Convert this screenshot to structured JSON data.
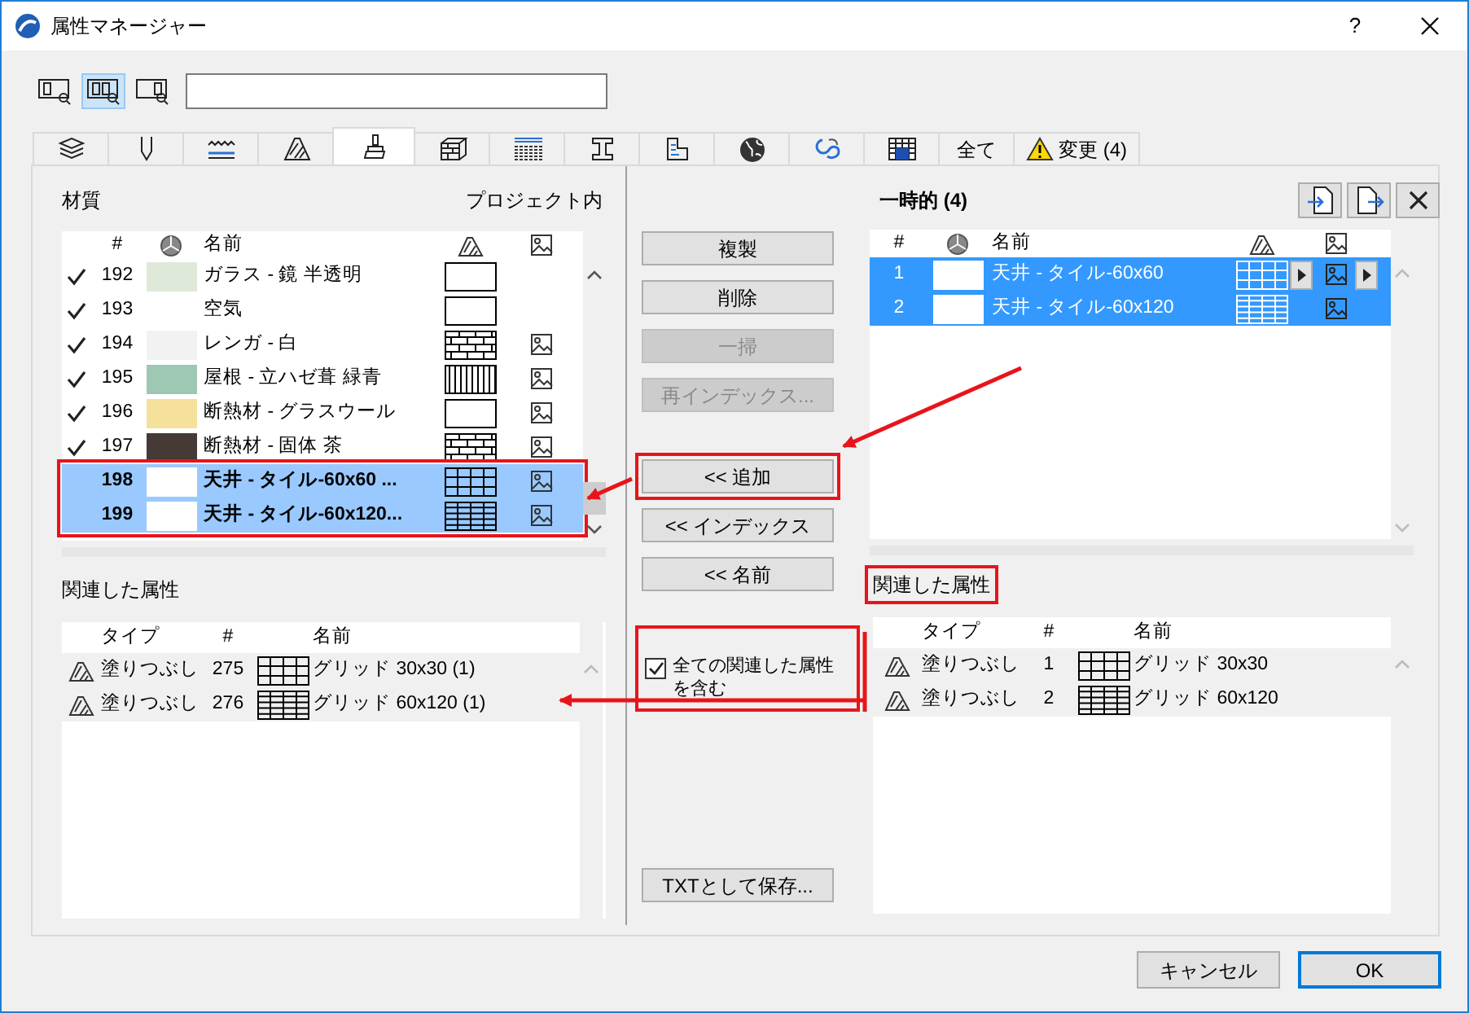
{
  "window": {
    "title": "属性マネージャー",
    "help": "?"
  },
  "view_buttons": [
    {
      "selected": false
    },
    {
      "selected": true
    },
    {
      "selected": false
    }
  ],
  "tabs": [
    {
      "kind": "icon",
      "selected": false
    },
    {
      "kind": "icon",
      "selected": false
    },
    {
      "kind": "icon",
      "selected": false
    },
    {
      "kind": "icon",
      "selected": false
    },
    {
      "kind": "icon",
      "selected": true
    },
    {
      "kind": "icon",
      "selected": false
    },
    {
      "kind": "icon",
      "selected": false
    },
    {
      "kind": "icon",
      "selected": false
    },
    {
      "kind": "icon",
      "selected": false
    },
    {
      "kind": "icon",
      "selected": false
    },
    {
      "kind": "icon",
      "selected": false
    },
    {
      "kind": "icon",
      "selected": false
    },
    {
      "kind": "text",
      "label": "全て",
      "selected": false
    },
    {
      "kind": "warning",
      "label": "変更 (4)",
      "selected": false
    }
  ],
  "left": {
    "title": "材質",
    "scope": "プロジェクト内",
    "focused": false,
    "highlight_selection": true,
    "columns": {
      "number": "#",
      "name": "名前"
    },
    "rows": [
      {
        "checked": true,
        "number": "192",
        "color": "#dfe9d9",
        "name": "ガラス - 鏡 半透明",
        "fill": {
          "kind": "empty"
        },
        "texture": false,
        "selected": false
      },
      {
        "checked": true,
        "number": "193",
        "name": "空気",
        "fill": {
          "kind": "empty"
        },
        "texture": false,
        "selected": false
      },
      {
        "checked": true,
        "number": "194",
        "color": "#f2f2f2",
        "name": "レンガ - 白",
        "fill": {
          "kind": "brick"
        },
        "texture": true,
        "selected": false
      },
      {
        "checked": true,
        "number": "195",
        "color": "#9ec7b4",
        "name": "屋根 - 立ハゼ葺 緑青",
        "fill": {
          "kind": "stripes"
        },
        "texture": true,
        "selected": false
      },
      {
        "checked": true,
        "number": "196",
        "color": "#f5e19c",
        "name": "断熱材 - グラスウール",
        "fill": {
          "kind": "empty"
        },
        "texture": true,
        "selected": false
      },
      {
        "checked": true,
        "number": "197",
        "color": "#453a36",
        "name": "断熱材 - 固体 茶",
        "fill": {
          "kind": "brick"
        },
        "texture": true,
        "selected": false
      },
      {
        "checked": false,
        "number": "198",
        "color": "#ffffff",
        "name": "天井 - タイル-60x60 ...",
        "fill": {
          "kind": "grid"
        },
        "texture": true,
        "selected": true
      },
      {
        "checked": false,
        "number": "199",
        "color": "#ffffff",
        "name": "天井 - タイル-60x120...",
        "fill": {
          "kind": "dense"
        },
        "texture": true,
        "selected": true
      }
    ]
  },
  "related_left": {
    "title": "関連した属性",
    "highlighted": false,
    "columns": {
      "type": "タイプ",
      "number": "#",
      "name": "名前"
    },
    "rows": [
      {
        "type": "塗りつぶし",
        "number": "275",
        "fill": {
          "kind": "grid"
        },
        "name": "グリッド 30x30 (1)"
      },
      {
        "type": "塗りつぶし",
        "number": "276",
        "fill": {
          "kind": "dense"
        },
        "name": "グリッド 60x120 (1)"
      }
    ]
  },
  "actions": [
    {
      "label": "複製",
      "disabled": false,
      "highlighted": false
    },
    {
      "label": "削除",
      "disabled": false,
      "highlighted": false
    },
    {
      "label": "一掃",
      "disabled": true,
      "highlighted": false
    },
    {
      "label": "再インデックス...",
      "disabled": true,
      "highlighted": false
    },
    {
      "label": "<< 追加",
      "disabled": false,
      "highlighted": true
    },
    {
      "label": "<< インデックス",
      "disabled": false,
      "highlighted": false
    },
    {
      "label": "<< 名前",
      "disabled": false,
      "highlighted": false
    }
  ],
  "include_related": {
    "label": "全ての関連した属性を含む",
    "checked": true,
    "highlighted": true
  },
  "save_button": {
    "label": "TXTとして保存..."
  },
  "right": {
    "title": "一時的 (4)",
    "focused": true,
    "highlight_selection": false,
    "columns": {
      "number": "#",
      "name": "名前"
    },
    "rows": [
      {
        "number": "1",
        "color": "#ffffff",
        "name": "天井 - タイル-60x60",
        "fill": {
          "kind": "grid"
        },
        "texture": true,
        "menu_buttons": true,
        "selected": true
      },
      {
        "number": "2",
        "color": "#ffffff",
        "name": "天井 - タイル-60x120",
        "fill": {
          "kind": "dense"
        },
        "texture": true,
        "menu_buttons": false,
        "selected": true
      }
    ]
  },
  "related_right": {
    "title": "関連した属性",
    "highlighted": true,
    "columns": {
      "type": "タイプ",
      "number": "#",
      "name": "名前"
    },
    "rows": [
      {
        "type": "塗りつぶし",
        "number": "1",
        "fill": {
          "kind": "grid"
        },
        "name": "グリッド 30x30"
      },
      {
        "type": "塗りつぶし",
        "number": "2",
        "fill": {
          "kind": "dense"
        },
        "name": "グリッド 60x120"
      }
    ]
  },
  "footer": [
    {
      "label": "キャンセル",
      "default": false
    },
    {
      "label": "OK",
      "default": true
    }
  ]
}
